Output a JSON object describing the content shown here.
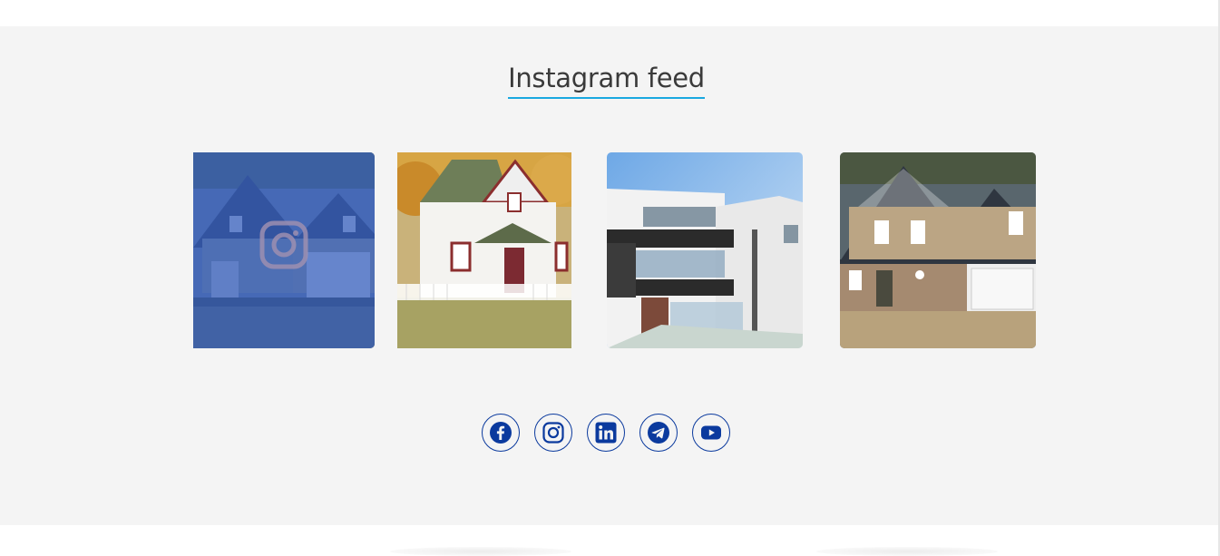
{
  "feed": {
    "title": "Instagram feed"
  },
  "tiles": [
    {
      "name": "instagram-post-1",
      "hovered": true,
      "overlay_icon": "instagram-icon"
    },
    {
      "name": "instagram-post-2",
      "hovered": false
    },
    {
      "name": "instagram-post-3",
      "hovered": false
    },
    {
      "name": "instagram-post-4",
      "hovered": false
    }
  ],
  "socials": [
    {
      "icon": "facebook-icon"
    },
    {
      "icon": "instagram-icon"
    },
    {
      "icon": "linkedin-icon"
    },
    {
      "icon": "telegram-icon"
    },
    {
      "icon": "youtube-icon"
    }
  ],
  "colors": {
    "section_background": "#f4f4f4",
    "title_underline": "#19a8e0",
    "social_icon": "#0b3a9e",
    "hover_overlay": "#305cbe"
  }
}
